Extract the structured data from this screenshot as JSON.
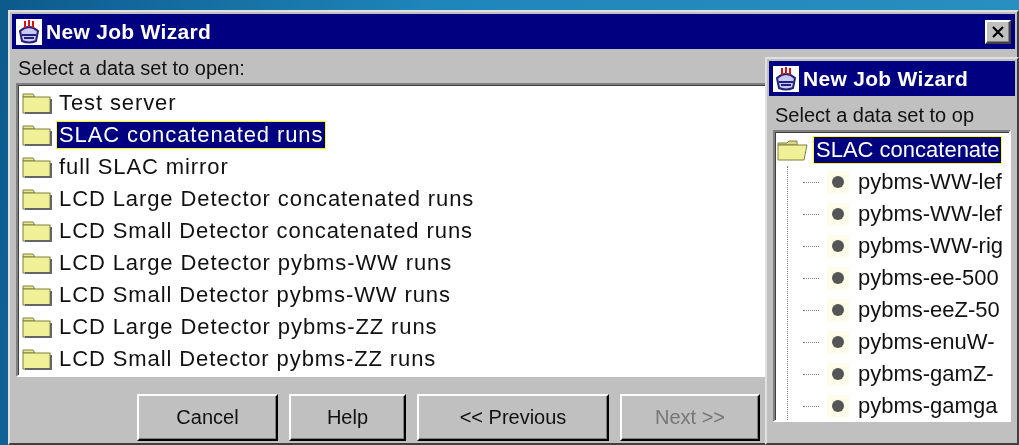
{
  "main_window": {
    "title": "New Job Wizard",
    "prompt": "Select a data set to open:",
    "data_sets": [
      {
        "label": "Test server",
        "selected": false
      },
      {
        "label": "SLAC concatenated runs",
        "selected": true
      },
      {
        "label": "full SLAC mirror",
        "selected": false
      },
      {
        "label": "LCD Large Detector concatenated runs",
        "selected": false
      },
      {
        "label": "LCD Small Detector concatenated runs",
        "selected": false
      },
      {
        "label": "LCD Large Detector pybms-WW runs",
        "selected": false
      },
      {
        "label": "LCD Small Detector pybms-WW runs",
        "selected": false
      },
      {
        "label": "LCD Large Detector pybms-ZZ runs",
        "selected": false
      },
      {
        "label": "LCD Small Detector pybms-ZZ runs",
        "selected": false
      }
    ],
    "buttons": [
      {
        "label": "Cancel",
        "disabled": false
      },
      {
        "label": "Help",
        "disabled": false
      },
      {
        "label": "<< Previous",
        "disabled": false
      },
      {
        "label": "Next >>",
        "disabled": true
      }
    ]
  },
  "front_window": {
    "title": "New Job Wizard",
    "prompt": "Select a data set to op",
    "tree": {
      "label": "SLAC concatenate",
      "selected": true,
      "expanded": true,
      "children": [
        {
          "label": "pybms-WW-lef",
          "selected": false
        },
        {
          "label": "pybms-WW-lef",
          "selected": false
        },
        {
          "label": "pybms-WW-rig",
          "selected": false
        },
        {
          "label": "pybms-ee-500",
          "selected": false
        },
        {
          "label": "pybms-eeZ-50",
          "selected": false
        },
        {
          "label": "pybms-enuW-",
          "selected": false
        },
        {
          "label": "pybms-gamZ-",
          "selected": false
        },
        {
          "label": "pybms-gamga",
          "selected": false
        }
      ]
    }
  }
}
